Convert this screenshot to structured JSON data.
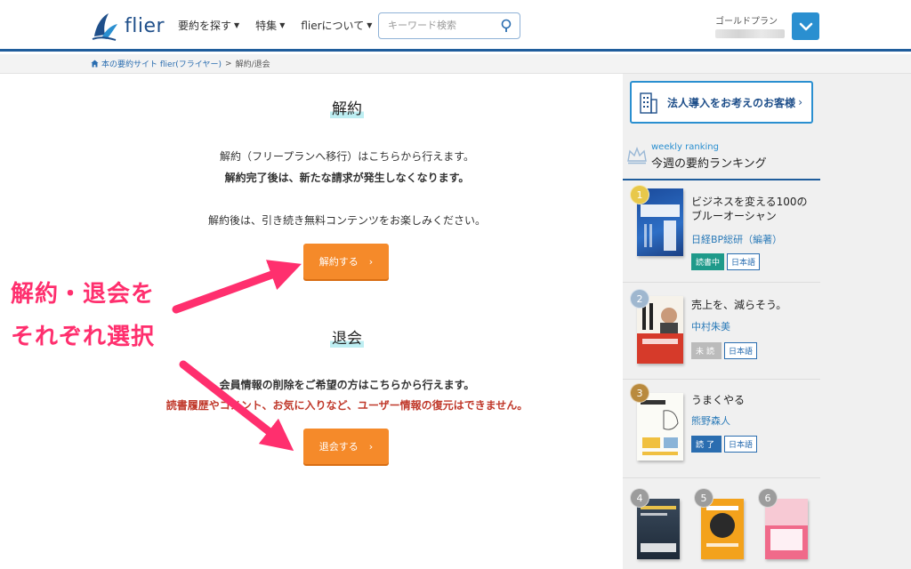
{
  "header": {
    "logo_text": "flier",
    "nav": [
      {
        "label": "要約を探す"
      },
      {
        "label": "特集"
      },
      {
        "label": "flierについて"
      }
    ],
    "search_placeholder": "キーワード検索",
    "plan_label": "ゴールドプラン"
  },
  "breadcrumb": {
    "home": "本の要約サイト flier(フライヤー)",
    "separator": ">",
    "current": "解約/退会"
  },
  "cancel": {
    "title": "解約",
    "line1": "解約（フリープランへ移行）はこちらから行えます。",
    "line2": "解約完了後は、新たな請求が発生しなくなります。",
    "line3": "解約後は、引き続き無料コンテンツをお楽しみください。",
    "button": "解約する"
  },
  "withdraw": {
    "title": "退会",
    "line1": "会員情報の削除をご希望の方はこちらから行えます。",
    "line2": "読書履歴やコメント、お気に入りなど、ユーザー情報の復元はできません。",
    "button": "退会する"
  },
  "annotation": {
    "line1": "解約・退会を",
    "line2": "それぞれ選択",
    "color": "#ff2f6e"
  },
  "sidebar": {
    "corporate_button": "法人導入をお考えのお客様",
    "ranking_sub": "weekly ranking",
    "ranking_title": "今週の要約ランキング",
    "items": [
      {
        "rank": "1",
        "title": "ビジネスを変える100のブルーオーシャン",
        "author": "日経BP総研（編著）",
        "status": "読書中",
        "lang": "日本語"
      },
      {
        "rank": "2",
        "title": "売上を、減らそう。",
        "author": "中村朱美",
        "status": "未読",
        "lang": "日本語"
      },
      {
        "rank": "3",
        "title": "うまくやる",
        "author": "熊野森人",
        "status": "読了",
        "lang": "日本語"
      }
    ],
    "more_ranks": [
      "4",
      "5",
      "6"
    ]
  },
  "colors": {
    "accent_orange": "#f58a2a",
    "brand_blue": "#1f5d9c",
    "warning_red": "#c0392b"
  }
}
